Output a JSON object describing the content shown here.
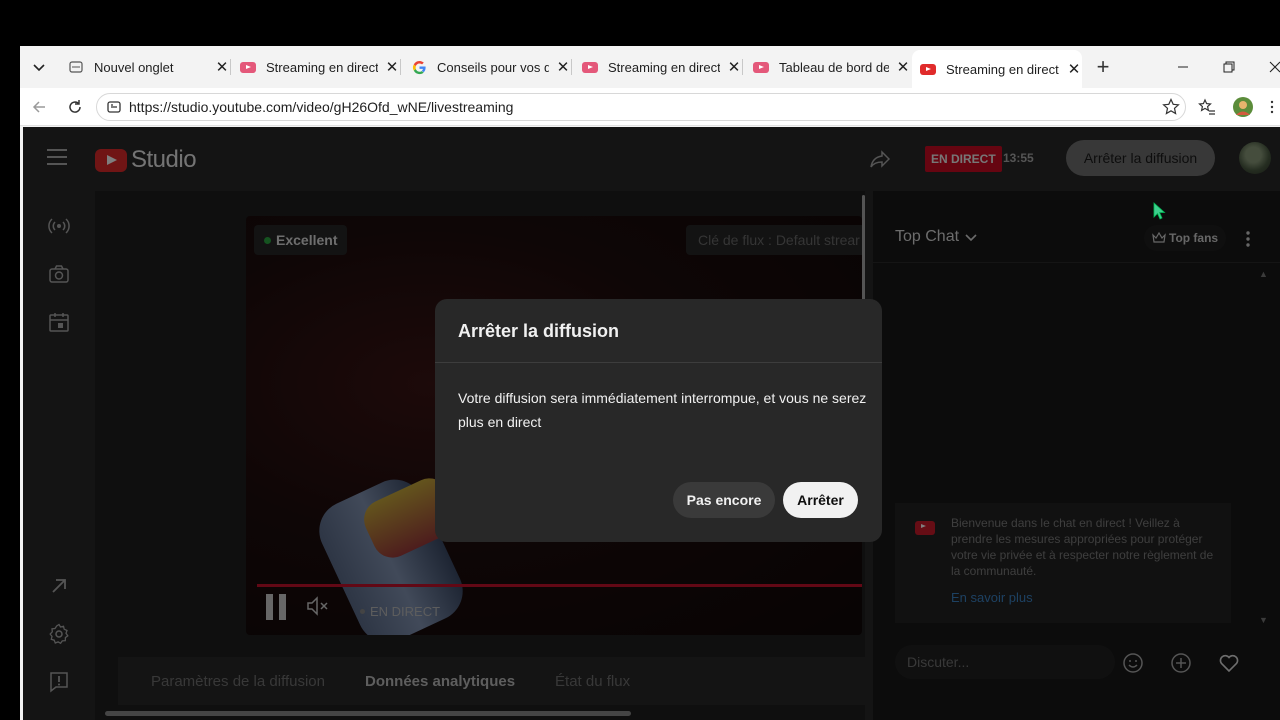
{
  "browser": {
    "tabs": [
      {
        "label": "Nouvel onglet",
        "icon": "new-tab-icon"
      },
      {
        "label": "Streaming en direct -",
        "icon": "youtube-icon"
      },
      {
        "label": "Conseils pour vos diff",
        "icon": "google-icon"
      },
      {
        "label": "Streaming en direct -",
        "icon": "youtube-icon"
      },
      {
        "label": "Tableau de bord de la",
        "icon": "youtube-icon"
      },
      {
        "label": "Streaming en direct -",
        "icon": "youtube-icon",
        "active": true
      }
    ],
    "new_tab": "+",
    "url": "https://studio.youtube.com/video/gH26Ofd_wNE/livestreaming"
  },
  "studio": {
    "logo_text": "Studio",
    "live_badge": "EN DIRECT",
    "live_time": "13:55",
    "stop_button": "Arrêter la diffusion"
  },
  "player": {
    "quality": "Excellent",
    "stream_key": "Clé de flux : Default strear",
    "live_label": "EN DIRECT"
  },
  "tabs": [
    "Paramètres de la diffusion",
    "Données analytiques",
    "État du flux"
  ],
  "chat": {
    "title": "Top Chat",
    "top_fans": "Top fans",
    "welcome_text": "Bienvenue dans le chat en direct ! Veillez à prendre les mesures appropriées pour protéger votre vie privée et à respecter notre règlement de la communauté.",
    "learn_more": "En savoir plus",
    "input_placeholder": "Discuter..."
  },
  "modal": {
    "title": "Arrêter la diffusion",
    "body": "Votre diffusion sera immédiatement interrompue, et vous ne serez plus en direct",
    "cancel": "Pas encore",
    "confirm": "Arrêter"
  },
  "colors": {
    "accent_red": "#cc0a23",
    "link_blue": "#3b82c4",
    "good_green": "#2ba640"
  }
}
